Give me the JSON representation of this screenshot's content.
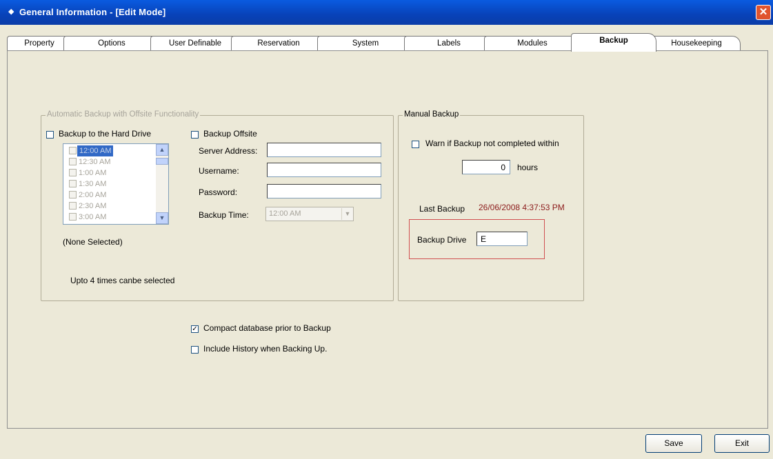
{
  "window": {
    "title": "General Information - [Edit Mode]",
    "close_symbol": "✕"
  },
  "tabs": [
    "Property",
    "Options",
    "User Definable",
    "Reservation",
    "System",
    "Labels",
    "Modules",
    "Backup",
    "Housekeeping"
  ],
  "auto": {
    "legend": "Automatic Backup with Offsite Functionality",
    "hard_drive_label": "Backup to the Hard Drive",
    "times": [
      "12:00 AM",
      "12:30 AM",
      "1:00 AM",
      "1:30 AM",
      "2:00 AM",
      "2:30 AM",
      "3:00 AM"
    ],
    "none_selected": "(None Selected)",
    "upto_note": "Upto 4 times canbe selected",
    "offsite_label": "Backup Offsite",
    "server_label": "Server Address:",
    "username_label": "Username:",
    "password_label": "Password:",
    "backup_time_label": "Backup Time:",
    "backup_time_value": "12:00 AM"
  },
  "manual": {
    "legend": "Manual Backup",
    "warn_label": "Warn if Backup not completed within",
    "hours_value": "0",
    "hours_label": "hours",
    "last_backup_label": "Last Backup",
    "last_backup_value": "26/06/2008 4:37:53 PM",
    "drive_label": "Backup Drive",
    "drive_value": "E"
  },
  "options": {
    "compact_label": "Compact database prior to Backup",
    "compact_checked": "✓",
    "history_label": "Include History when Backing Up."
  },
  "buttons": {
    "save": "Save",
    "exit": "Exit"
  },
  "colors": {
    "last_backup": "#8B1A1A",
    "title_bar": "#0842B8"
  }
}
